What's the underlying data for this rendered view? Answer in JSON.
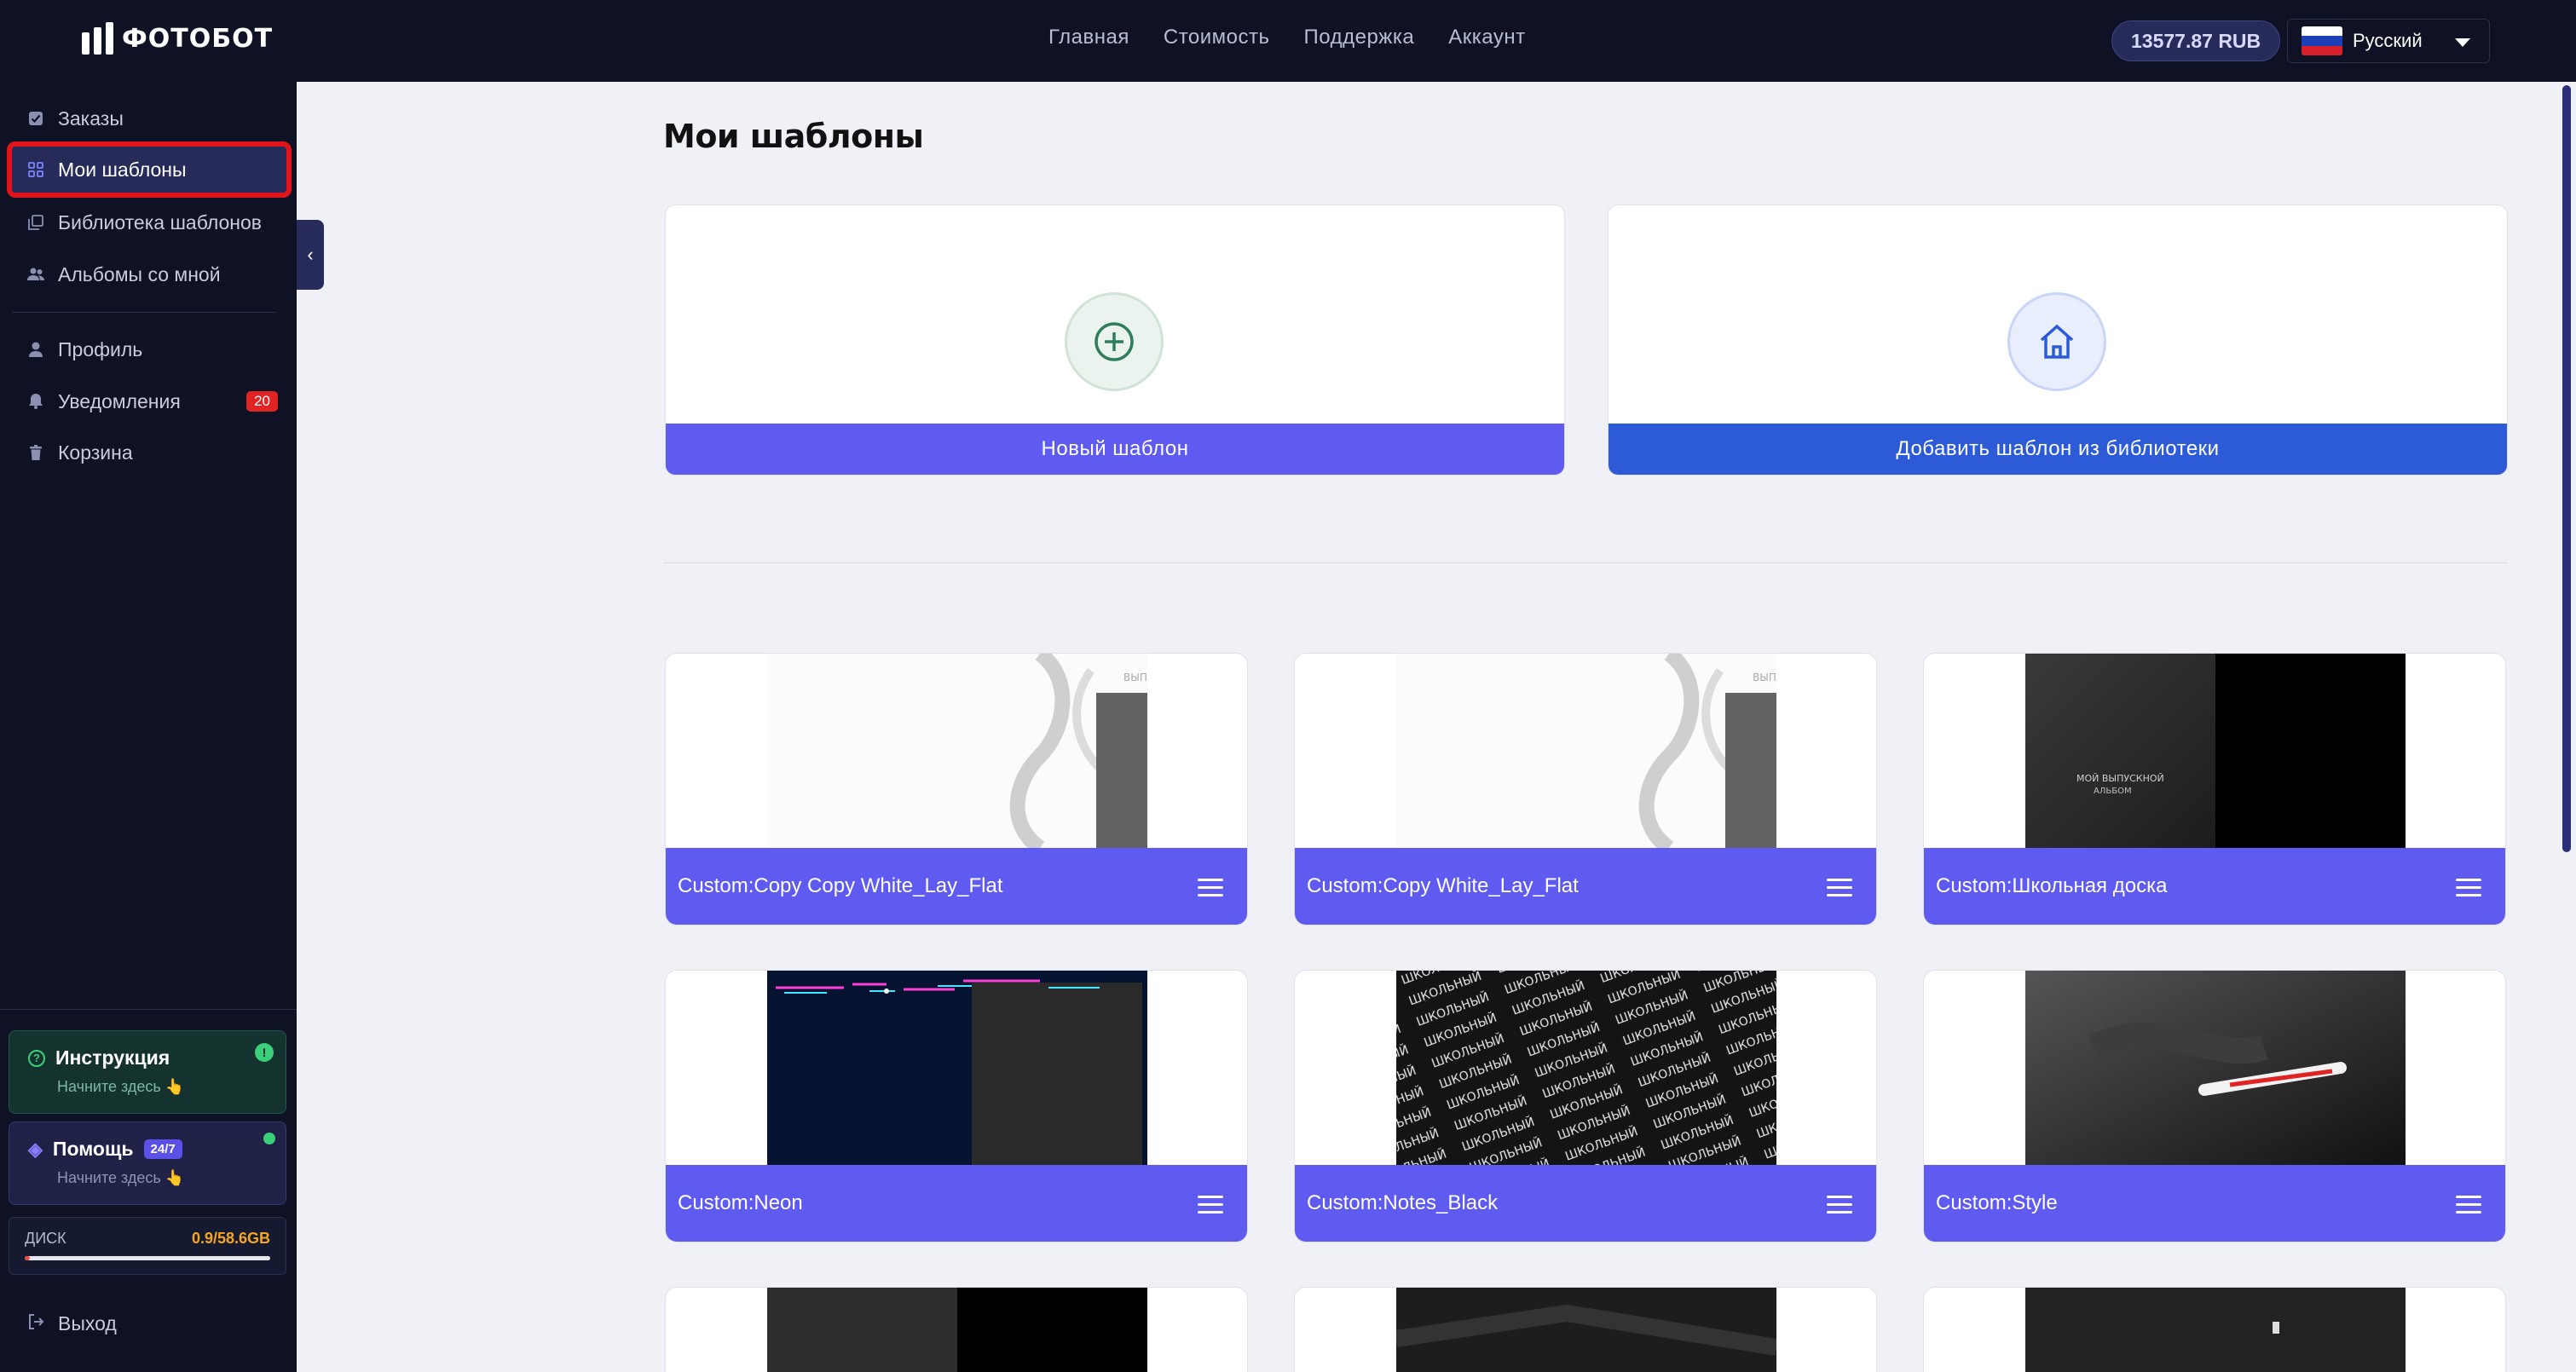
{
  "brand": {
    "logo_text": "ФОТОБОТ"
  },
  "nav": {
    "items": [
      "Главная",
      "Стоимость",
      "Поддержка",
      "Аккаунт"
    ]
  },
  "header": {
    "balance": "13577.87 RUB",
    "language": "Русский"
  },
  "sidebar": {
    "items": [
      {
        "label": "Заказы",
        "icon": "checkbox-icon"
      },
      {
        "label": "Мои шаблоны",
        "icon": "grid-icon",
        "active": true
      },
      {
        "label": "Библиотека шаблонов",
        "icon": "library-icon"
      },
      {
        "label": "Альбомы со мной",
        "icon": "people-icon"
      },
      {
        "label": "Профиль",
        "icon": "person-icon"
      },
      {
        "label": "Уведомления",
        "icon": "bell-icon",
        "badge": "20"
      },
      {
        "label": "Корзина",
        "icon": "trash-icon"
      }
    ],
    "instruction": {
      "title": "Инструкция",
      "sub": "Начните здесь 👆",
      "badge": "!"
    },
    "help": {
      "title": "Помощь",
      "tag": "24/7",
      "sub": "Начните здесь 👆"
    },
    "disk": {
      "label": "ДИСК",
      "usage": "0.9/58.6GB",
      "fraction": 0.015
    },
    "logout": "Выход"
  },
  "main": {
    "title": "Мои шаблоны",
    "new_template": "Новый шаблон",
    "add_from_library": "Добавить шаблон из библиотеки",
    "templates": [
      {
        "name": "Custom:Copy Copy White_Lay_Flat"
      },
      {
        "name": "Custom:Copy White_Lay_Flat"
      },
      {
        "name": "Custom:Школьная доска"
      },
      {
        "name": "Custom:Neon"
      },
      {
        "name": "Custom:Notes_Black"
      },
      {
        "name": "Custom:Style"
      }
    ]
  },
  "colors": {
    "accent": "#5f5af0",
    "library_blue": "#2d5bd8",
    "sidebar_bg": "#0f1224",
    "badge_red": "#e02424"
  }
}
